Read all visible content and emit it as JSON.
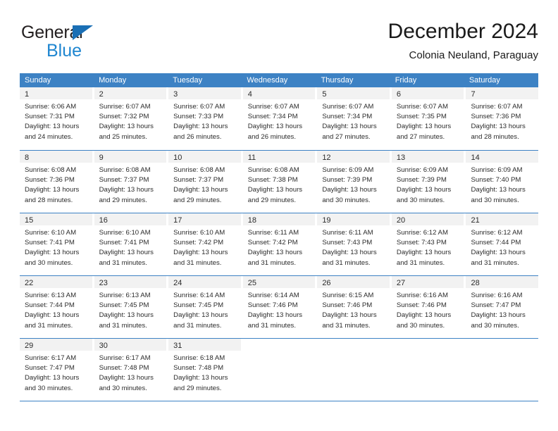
{
  "brand": {
    "name_primary": "General",
    "name_secondary": "Blue",
    "triangle_color": "#1a6fb5",
    "secondary_color": "#1f86d0"
  },
  "header": {
    "title": "December 2024",
    "subtitle": "Colonia Neuland, Paraguay"
  },
  "theme": {
    "header_bg": "#3d82c4",
    "daynum_bg": "#f2f2f2",
    "text_color": "#2b2b2b"
  },
  "calendar": {
    "weekday_headers": [
      "Sunday",
      "Monday",
      "Tuesday",
      "Wednesday",
      "Thursday",
      "Friday",
      "Saturday"
    ],
    "weeks": [
      [
        {
          "day": "1",
          "sunrise": "Sunrise: 6:06 AM",
          "sunset": "Sunset: 7:31 PM",
          "daylight_1": "Daylight: 13 hours",
          "daylight_2": "and 24 minutes."
        },
        {
          "day": "2",
          "sunrise": "Sunrise: 6:07 AM",
          "sunset": "Sunset: 7:32 PM",
          "daylight_1": "Daylight: 13 hours",
          "daylight_2": "and 25 minutes."
        },
        {
          "day": "3",
          "sunrise": "Sunrise: 6:07 AM",
          "sunset": "Sunset: 7:33 PM",
          "daylight_1": "Daylight: 13 hours",
          "daylight_2": "and 26 minutes."
        },
        {
          "day": "4",
          "sunrise": "Sunrise: 6:07 AM",
          "sunset": "Sunset: 7:34 PM",
          "daylight_1": "Daylight: 13 hours",
          "daylight_2": "and 26 minutes."
        },
        {
          "day": "5",
          "sunrise": "Sunrise: 6:07 AM",
          "sunset": "Sunset: 7:34 PM",
          "daylight_1": "Daylight: 13 hours",
          "daylight_2": "and 27 minutes."
        },
        {
          "day": "6",
          "sunrise": "Sunrise: 6:07 AM",
          "sunset": "Sunset: 7:35 PM",
          "daylight_1": "Daylight: 13 hours",
          "daylight_2": "and 27 minutes."
        },
        {
          "day": "7",
          "sunrise": "Sunrise: 6:07 AM",
          "sunset": "Sunset: 7:36 PM",
          "daylight_1": "Daylight: 13 hours",
          "daylight_2": "and 28 minutes."
        }
      ],
      [
        {
          "day": "8",
          "sunrise": "Sunrise: 6:08 AM",
          "sunset": "Sunset: 7:36 PM",
          "daylight_1": "Daylight: 13 hours",
          "daylight_2": "and 28 minutes."
        },
        {
          "day": "9",
          "sunrise": "Sunrise: 6:08 AM",
          "sunset": "Sunset: 7:37 PM",
          "daylight_1": "Daylight: 13 hours",
          "daylight_2": "and 29 minutes."
        },
        {
          "day": "10",
          "sunrise": "Sunrise: 6:08 AM",
          "sunset": "Sunset: 7:37 PM",
          "daylight_1": "Daylight: 13 hours",
          "daylight_2": "and 29 minutes."
        },
        {
          "day": "11",
          "sunrise": "Sunrise: 6:08 AM",
          "sunset": "Sunset: 7:38 PM",
          "daylight_1": "Daylight: 13 hours",
          "daylight_2": "and 29 minutes."
        },
        {
          "day": "12",
          "sunrise": "Sunrise: 6:09 AM",
          "sunset": "Sunset: 7:39 PM",
          "daylight_1": "Daylight: 13 hours",
          "daylight_2": "and 30 minutes."
        },
        {
          "day": "13",
          "sunrise": "Sunrise: 6:09 AM",
          "sunset": "Sunset: 7:39 PM",
          "daylight_1": "Daylight: 13 hours",
          "daylight_2": "and 30 minutes."
        },
        {
          "day": "14",
          "sunrise": "Sunrise: 6:09 AM",
          "sunset": "Sunset: 7:40 PM",
          "daylight_1": "Daylight: 13 hours",
          "daylight_2": "and 30 minutes."
        }
      ],
      [
        {
          "day": "15",
          "sunrise": "Sunrise: 6:10 AM",
          "sunset": "Sunset: 7:41 PM",
          "daylight_1": "Daylight: 13 hours",
          "daylight_2": "and 30 minutes."
        },
        {
          "day": "16",
          "sunrise": "Sunrise: 6:10 AM",
          "sunset": "Sunset: 7:41 PM",
          "daylight_1": "Daylight: 13 hours",
          "daylight_2": "and 31 minutes."
        },
        {
          "day": "17",
          "sunrise": "Sunrise: 6:10 AM",
          "sunset": "Sunset: 7:42 PM",
          "daylight_1": "Daylight: 13 hours",
          "daylight_2": "and 31 minutes."
        },
        {
          "day": "18",
          "sunrise": "Sunrise: 6:11 AM",
          "sunset": "Sunset: 7:42 PM",
          "daylight_1": "Daylight: 13 hours",
          "daylight_2": "and 31 minutes."
        },
        {
          "day": "19",
          "sunrise": "Sunrise: 6:11 AM",
          "sunset": "Sunset: 7:43 PM",
          "daylight_1": "Daylight: 13 hours",
          "daylight_2": "and 31 minutes."
        },
        {
          "day": "20",
          "sunrise": "Sunrise: 6:12 AM",
          "sunset": "Sunset: 7:43 PM",
          "daylight_1": "Daylight: 13 hours",
          "daylight_2": "and 31 minutes."
        },
        {
          "day": "21",
          "sunrise": "Sunrise: 6:12 AM",
          "sunset": "Sunset: 7:44 PM",
          "daylight_1": "Daylight: 13 hours",
          "daylight_2": "and 31 minutes."
        }
      ],
      [
        {
          "day": "22",
          "sunrise": "Sunrise: 6:13 AM",
          "sunset": "Sunset: 7:44 PM",
          "daylight_1": "Daylight: 13 hours",
          "daylight_2": "and 31 minutes."
        },
        {
          "day": "23",
          "sunrise": "Sunrise: 6:13 AM",
          "sunset": "Sunset: 7:45 PM",
          "daylight_1": "Daylight: 13 hours",
          "daylight_2": "and 31 minutes."
        },
        {
          "day": "24",
          "sunrise": "Sunrise: 6:14 AM",
          "sunset": "Sunset: 7:45 PM",
          "daylight_1": "Daylight: 13 hours",
          "daylight_2": "and 31 minutes."
        },
        {
          "day": "25",
          "sunrise": "Sunrise: 6:14 AM",
          "sunset": "Sunset: 7:46 PM",
          "daylight_1": "Daylight: 13 hours",
          "daylight_2": "and 31 minutes."
        },
        {
          "day": "26",
          "sunrise": "Sunrise: 6:15 AM",
          "sunset": "Sunset: 7:46 PM",
          "daylight_1": "Daylight: 13 hours",
          "daylight_2": "and 31 minutes."
        },
        {
          "day": "27",
          "sunrise": "Sunrise: 6:16 AM",
          "sunset": "Sunset: 7:46 PM",
          "daylight_1": "Daylight: 13 hours",
          "daylight_2": "and 30 minutes."
        },
        {
          "day": "28",
          "sunrise": "Sunrise: 6:16 AM",
          "sunset": "Sunset: 7:47 PM",
          "daylight_1": "Daylight: 13 hours",
          "daylight_2": "and 30 minutes."
        }
      ],
      [
        {
          "day": "29",
          "sunrise": "Sunrise: 6:17 AM",
          "sunset": "Sunset: 7:47 PM",
          "daylight_1": "Daylight: 13 hours",
          "daylight_2": "and 30 minutes."
        },
        {
          "day": "30",
          "sunrise": "Sunrise: 6:17 AM",
          "sunset": "Sunset: 7:48 PM",
          "daylight_1": "Daylight: 13 hours",
          "daylight_2": "and 30 minutes."
        },
        {
          "day": "31",
          "sunrise": "Sunrise: 6:18 AM",
          "sunset": "Sunset: 7:48 PM",
          "daylight_1": "Daylight: 13 hours",
          "daylight_2": "and 29 minutes."
        },
        {
          "day": "",
          "sunrise": "",
          "sunset": "",
          "daylight_1": "",
          "daylight_2": ""
        },
        {
          "day": "",
          "sunrise": "",
          "sunset": "",
          "daylight_1": "",
          "daylight_2": ""
        },
        {
          "day": "",
          "sunrise": "",
          "sunset": "",
          "daylight_1": "",
          "daylight_2": ""
        },
        {
          "day": "",
          "sunrise": "",
          "sunset": "",
          "daylight_1": "",
          "daylight_2": ""
        }
      ]
    ]
  }
}
